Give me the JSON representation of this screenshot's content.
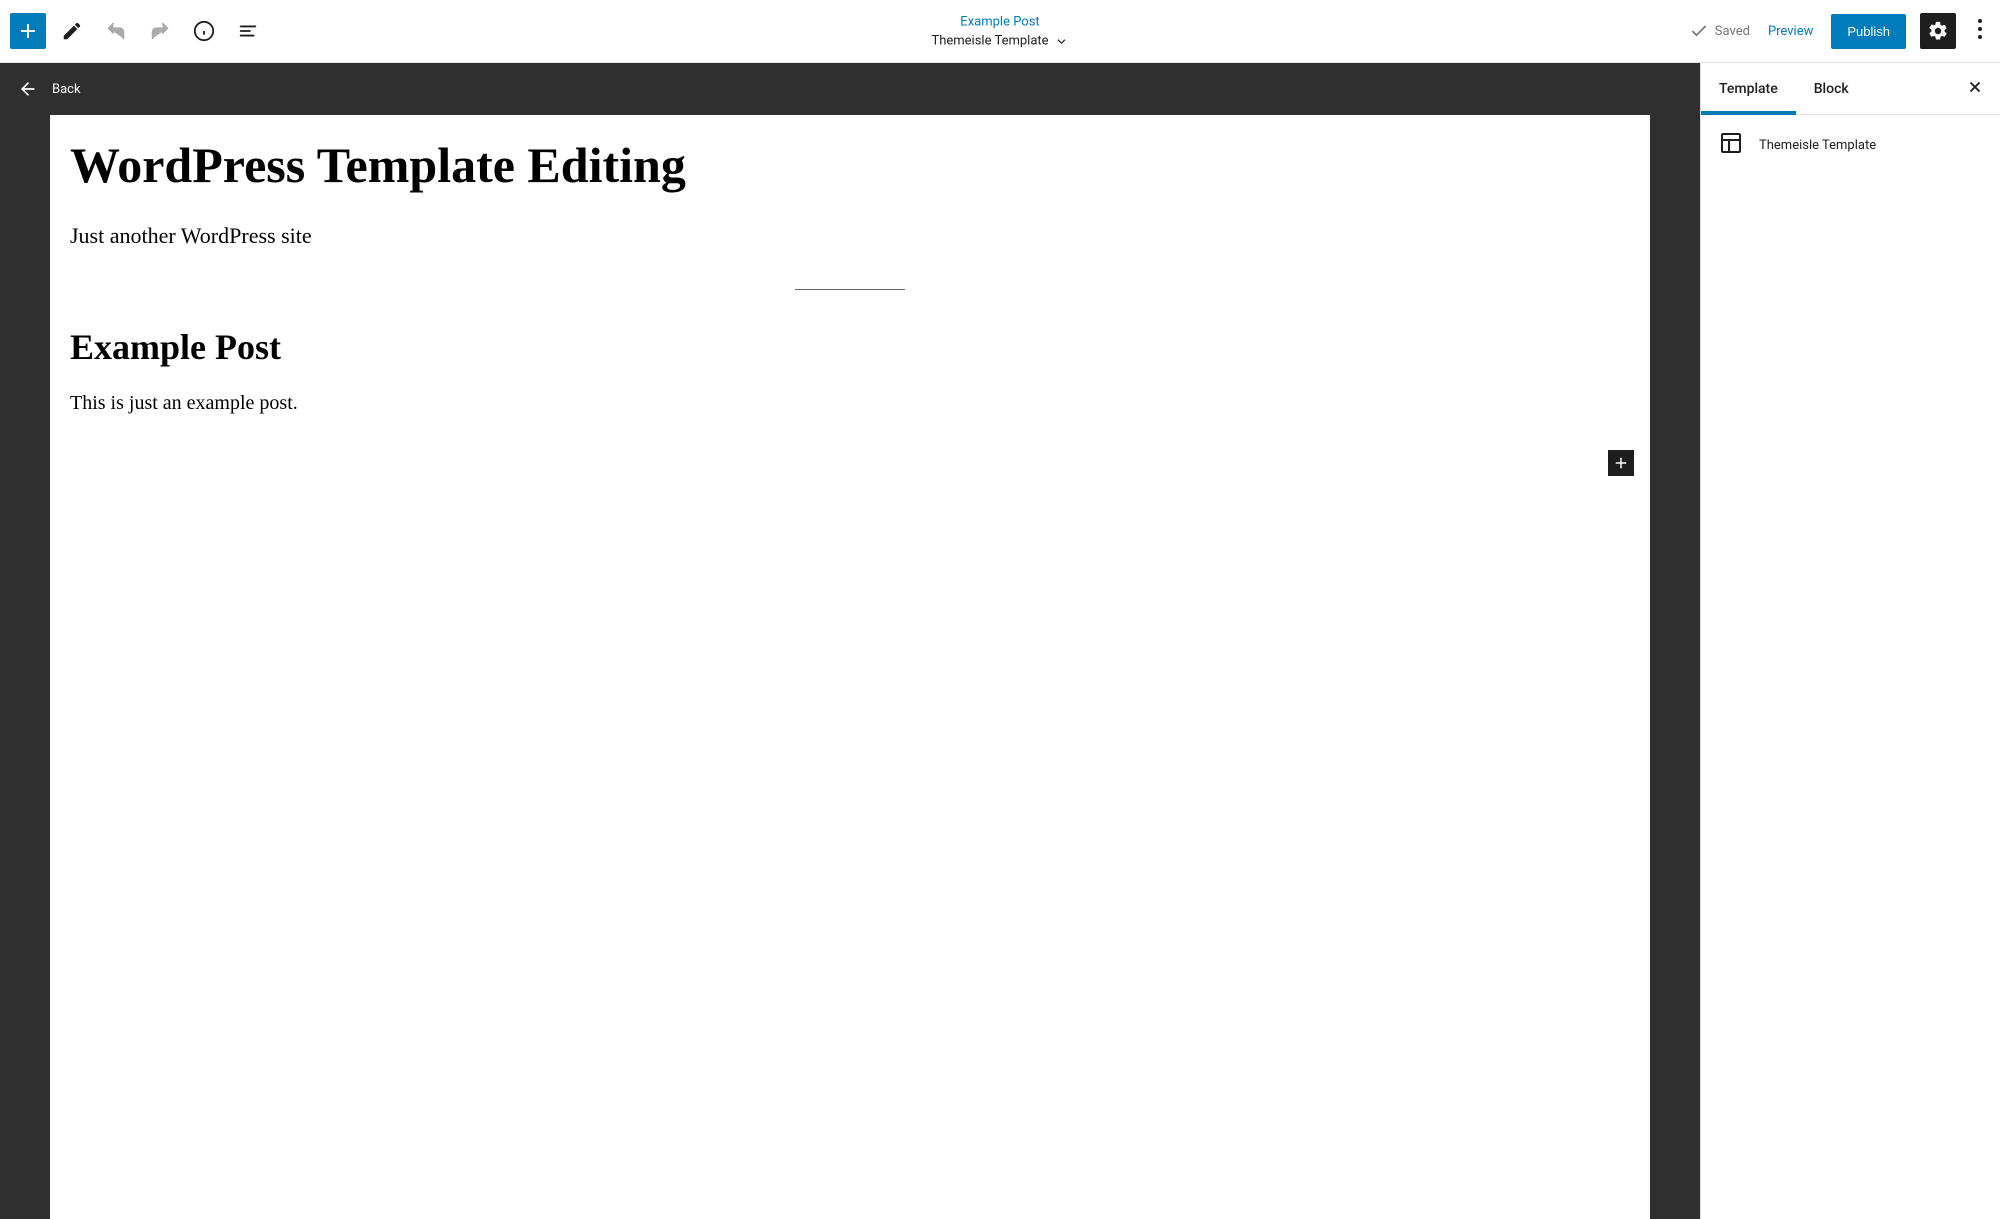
{
  "topbar": {
    "post_title": "Example Post",
    "template_name": "Themeisle Template",
    "saved_label": "Saved",
    "preview_label": "Preview",
    "publish_label": "Publish"
  },
  "back_label": "Back",
  "document": {
    "site_title": "WordPress Template Editing",
    "tagline": "Just another WordPress site",
    "post_title": "Example Post",
    "post_body": "This is just an example post."
  },
  "sidebar": {
    "tabs": {
      "template": "Template",
      "block": "Block"
    },
    "template_name": "Themeisle Template"
  }
}
